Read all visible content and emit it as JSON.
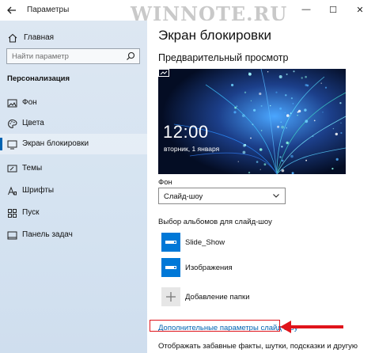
{
  "window": {
    "title": "Параметры",
    "watermark": "WINNOTE.RU",
    "controls": {
      "minimize": "—",
      "maximize": "☐",
      "close": "✕"
    }
  },
  "sidebar": {
    "home_label": "Главная",
    "search_placeholder": "Найти параметр",
    "section_title": "Персонализация",
    "items": [
      {
        "label": "Фон",
        "icon": "picture-icon"
      },
      {
        "label": "Цвета",
        "icon": "palette-icon"
      },
      {
        "label": "Экран блокировки",
        "icon": "lock-screen-icon",
        "active": true
      },
      {
        "label": "Темы",
        "icon": "brush-icon"
      },
      {
        "label": "Шрифты",
        "icon": "font-icon"
      },
      {
        "label": "Пуск",
        "icon": "start-icon"
      },
      {
        "label": "Панель задач",
        "icon": "taskbar-icon"
      }
    ]
  },
  "main": {
    "title": "Экран блокировки",
    "preview_heading": "Предварительный просмотр",
    "preview": {
      "time": "12:00",
      "date": "вторник, 1 января"
    },
    "background_label": "Фон",
    "background_value": "Слайд-шоу",
    "albums_label": "Выбор альбомов для слайд-шоу",
    "albums": [
      {
        "name": "Slide_Show"
      },
      {
        "name": "Изображения"
      }
    ],
    "add_folder_label": "Добавление папки",
    "advanced_link": "Дополнительные параметры слайд-шоу",
    "bottom_text": "Отображать забавные факты, шутки, подсказки и другую"
  },
  "colors": {
    "accent": "#0078d7",
    "link": "#0063b1",
    "highlight": "#e0141b",
    "sidebar_bg": "#d5e3f1"
  }
}
